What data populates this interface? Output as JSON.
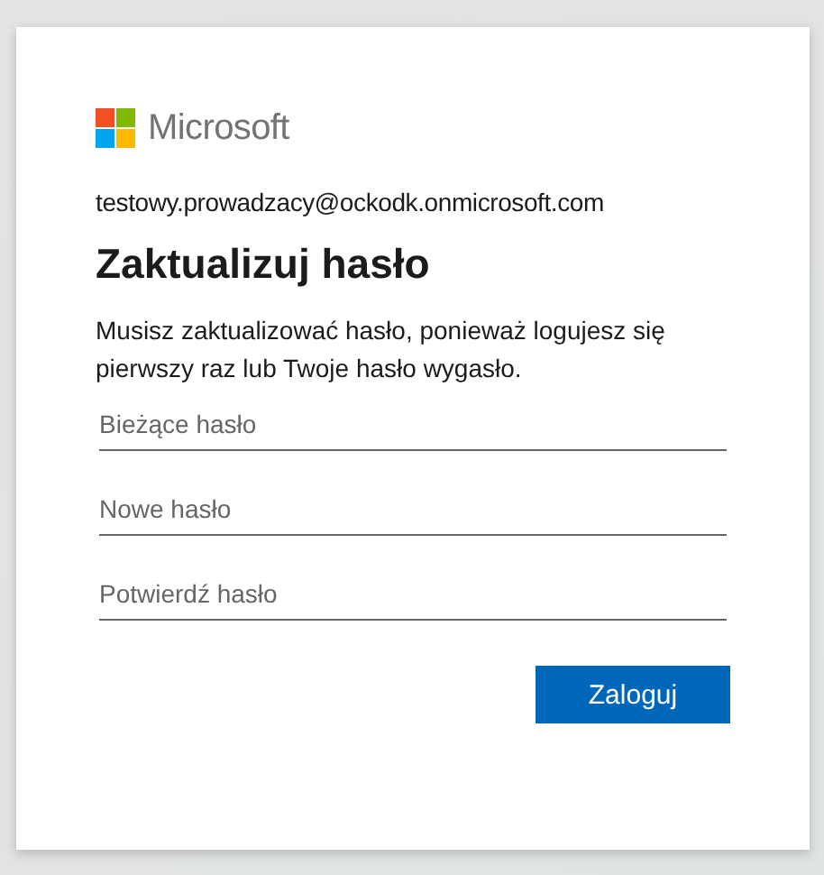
{
  "logo": {
    "text": "Microsoft"
  },
  "account": "testowy.prowadzacy@ockodk.onmicrosoft.com",
  "title": "Zaktualizuj hasło",
  "message": "Musisz zaktualizować hasło, ponieważ logujesz się pierwszy raz lub Twoje hasło wygasło.",
  "fields": [
    {
      "placeholder": "Bieżące hasło"
    },
    {
      "placeholder": "Nowe hasło"
    },
    {
      "placeholder": "Potwierdź hasło"
    }
  ],
  "buttons": [
    {
      "label": "Zaloguj",
      "kind": "primary"
    }
  ]
}
